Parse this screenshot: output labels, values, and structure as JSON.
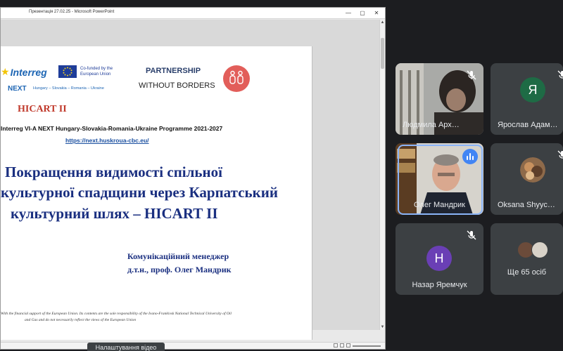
{
  "window": {
    "title": "Презентація 27.02.25 - Microsoft PowerPoint",
    "minimize": "—",
    "maximize": "▢",
    "close": "✕"
  },
  "slide": {
    "interreg_logo": "Interreg",
    "eu_cofunded": "Co-funded by the European Union",
    "next_label": "NEXT",
    "next_countries": "Hungary – Slovakia – Romania – Ukraine",
    "partnership": "PARTNERSHIP",
    "without_borders": "WITHOUT BORDERS",
    "project_short": "HICART II",
    "programme": "Interreg VI-A NEXT Hungary-Slovakia-Romania-Ukraine Programme 2021-2027",
    "programme_link": "https://next.huskroua-cbc.eu/",
    "title_lines": [
      "Покращення видимості спільної",
      "культурної спадщини через Карпатський",
      "культурний шлях – HICART II"
    ],
    "author_role": "Комунікаційний менеджер",
    "author_name": "д.т.н., проф. Олег Мандрик",
    "disclaimer_line1": "With the financial support of the European Union. Its contents are the sole responsibility of the Ivano-Frankivsk National Technical University of Oil",
    "disclaimer_line2": "and Gas and do not necessarily reflect the views of the European Union"
  },
  "tooltip": "Налаштування відео",
  "participants": [
    {
      "name": "Людмила Арх…",
      "type": "video",
      "muted": true
    },
    {
      "name": "Ярослав Адам…",
      "type": "avatar",
      "initial": "Я",
      "color": "#1e6b45",
      "muted": true
    },
    {
      "name": "Олег Мандрик",
      "type": "video",
      "speaking": true
    },
    {
      "name": "Oksana Shyyc…",
      "type": "photo-avatar",
      "muted": true
    },
    {
      "name": "Назар Яремчук",
      "type": "avatar",
      "initial": "Н",
      "color": "#6a3fb5",
      "muted": true
    },
    {
      "name": "Ще 65 осіб",
      "type": "more"
    }
  ],
  "colors": {
    "meet_background": "#1c1d20",
    "tile": "#3c4043",
    "speaking_border": "#8ab4f8",
    "title_text": "#1a2f80",
    "hicart_red": "#c0392b"
  }
}
